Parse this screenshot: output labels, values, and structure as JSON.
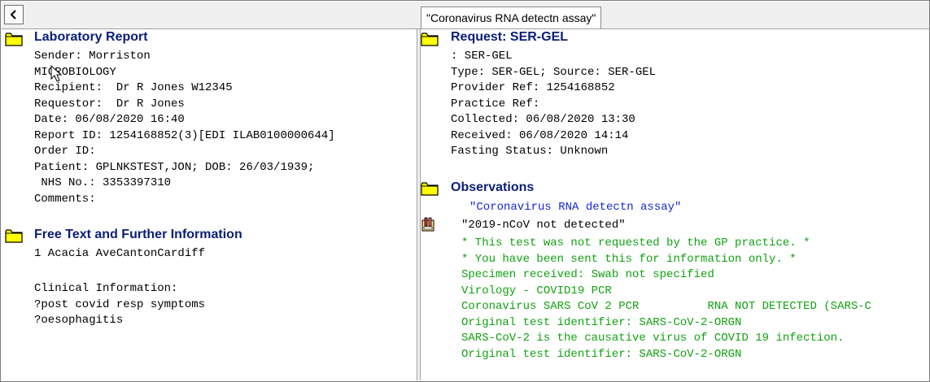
{
  "tab": {
    "label": "\"Coronavirus RNA detectn assay\""
  },
  "left": {
    "lab_report": {
      "title": "Laboratory Report",
      "lines": [
        "Sender: Morriston",
        "MICROBIOLOGY",
        "Recipient:  Dr R Jones W12345",
        "Requestor:  Dr R Jones",
        "Date: 06/08/2020 16:40",
        "Report ID: 1254168852(3)[EDI ILAB0100000644]",
        "Order ID:",
        "Patient: GPLNKSTEST,JON; DOB: 26/03/1939;",
        " NHS No.: 3353397310",
        "Comments:"
      ]
    },
    "free_text": {
      "title": "Free Text and Further Information",
      "lines": [
        "1 Acacia AveCantonCardiff",
        "",
        "Clinical Information:",
        "?post covid resp symptoms",
        "?oesophagitis"
      ]
    }
  },
  "right": {
    "request": {
      "title": "Request: SER-GEL",
      "lines": [
        ": SER-GEL",
        "Type: SER-GEL; Source: SER-GEL",
        "Provider Ref: 1254168852",
        "Practice Ref:",
        "Collected: 06/08/2020 13:30",
        "Received: 06/08/2020 14:14",
        "Fasting Status: Unknown"
      ]
    },
    "observations": {
      "title": "Observations",
      "test_name": "\"Coronavirus RNA detectn assay\"",
      "result": "\"2019-nCoV not detected\"",
      "comments": [
        "* This test was not requested by the GP practice. *",
        "* You have been sent this for information only. *",
        "Specimen received: Swab not specified",
        "Virology - COVID19 PCR",
        "Coronavirus SARS CoV 2 PCR          RNA NOT DETECTED (SARS-C",
        "Original test identifier: SARS-CoV-2-ORGN",
        "SARS-CoV-2 is the causative virus of COVID 19 infection.",
        "Original test identifier: SARS-CoV-2-ORGN"
      ]
    }
  },
  "icons": {
    "back": "chevron-left-icon",
    "folder": "folder-icon",
    "result": "lab-result-icon",
    "cursor": "mouse-pointer-icon"
  },
  "colors": {
    "heading": "#0a1e78",
    "comment_green": "#11a211",
    "test_blue": "#1428d8",
    "folder_yellow": "#ffff00"
  }
}
